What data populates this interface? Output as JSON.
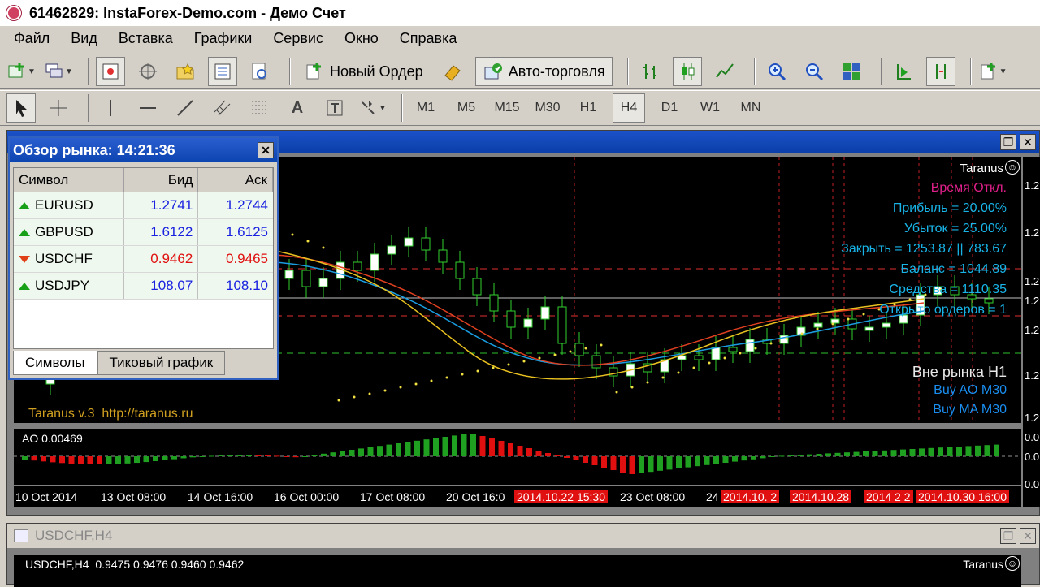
{
  "window": {
    "title": "61462829: InstaForex-Demo.com - Демо Счет"
  },
  "menu": [
    "Файл",
    "Вид",
    "Вставка",
    "Графики",
    "Сервис",
    "Окно",
    "Справка"
  ],
  "toolbar": {
    "new_order": "Новый Ордер",
    "auto_trading": "Авто-торговля"
  },
  "timeframes": [
    "M1",
    "M5",
    "M15",
    "M30",
    "H1",
    "H4",
    "D1",
    "W1",
    "MN"
  ],
  "active_timeframe": "H4",
  "market_watch": {
    "title": "Обзор рынка: 14:21:36",
    "headers": {
      "symbol": "Символ",
      "bid": "Бид",
      "ask": "Аск"
    },
    "rows": [
      {
        "symbol": "EURUSD",
        "bid": "1.2741",
        "ask": "1.2744",
        "direction": "up"
      },
      {
        "symbol": "GBPUSD",
        "bid": "1.6122",
        "ask": "1.6125",
        "direction": "up"
      },
      {
        "symbol": "USDCHF",
        "bid": "0.9462",
        "ask": "0.9465",
        "direction": "down"
      },
      {
        "symbol": "USDJPY",
        "bid": "108.07",
        "ask": "108.10",
        "direction": "up"
      }
    ],
    "tabs": [
      "Символы",
      "Тиковый график"
    ]
  },
  "chart": {
    "brand": "Taranus",
    "info_lines": [
      {
        "text": "Время Откл.",
        "color": "#e0208a"
      },
      {
        "text": "Прибыль = 20.00%",
        "color": "#18b4e8"
      },
      {
        "text": "Убыток = 25.00%",
        "color": "#18b4e8"
      },
      {
        "text": "Закрыть = 1253.87 || 783.67",
        "color": "#18b4e8"
      },
      {
        "text": "Баланс = 1044.89",
        "color": "#18b4e8"
      },
      {
        "text": "Средства = 1110.35",
        "color": "#18b4e8"
      },
      {
        "text": "Открыто ордеров = 1",
        "color": "#18b4e8"
      }
    ],
    "signals": [
      {
        "text": "Вне рынка H1",
        "color": "#e8e8e8"
      },
      {
        "text": "Buy AO M30",
        "color": "#1a8ef0"
      },
      {
        "text": "Buy MA M30",
        "color": "#1a8ef0"
      }
    ],
    "watermark": "Taranus v.3  http://taranus.ru",
    "ao_label": "AO 0.00469",
    "dates": [
      {
        "text": "10 Oct 2014",
        "red": false
      },
      {
        "text": "13 Oct 08:00",
        "red": false
      },
      {
        "text": "14 Oct 16:00",
        "red": false
      },
      {
        "text": "16 Oct 00:00",
        "red": false
      },
      {
        "text": "17 Oct 08:00",
        "red": false
      },
      {
        "text": "20 Oct 16:0",
        "red": false
      },
      {
        "text": "2014.10.22 15:30",
        "red": true
      },
      {
        "text": "23 Oct 08:00",
        "red": false
      },
      {
        "text": "24",
        "red": false
      },
      {
        "text": "2014.10. 2",
        "red": true
      },
      {
        "text": "2014.10.28",
        "red": true
      },
      {
        "text": "2014  2  2",
        "red": true
      },
      {
        "text": "2014.10.30 16:00",
        "red": true
      }
    ],
    "price_labels": [
      "1.2",
      "1.2",
      "1.2",
      "1.2",
      "1.2",
      "1.2",
      "1.2"
    ],
    "ao_price_labels": [
      "0.0",
      "0.0",
      "0.0"
    ]
  },
  "second_window": {
    "title": "USDCHF,H4",
    "quote_line": "USDCHF,H4  0.9475 0.9476 0.9460 0.9462",
    "brand": "Taranus"
  }
}
